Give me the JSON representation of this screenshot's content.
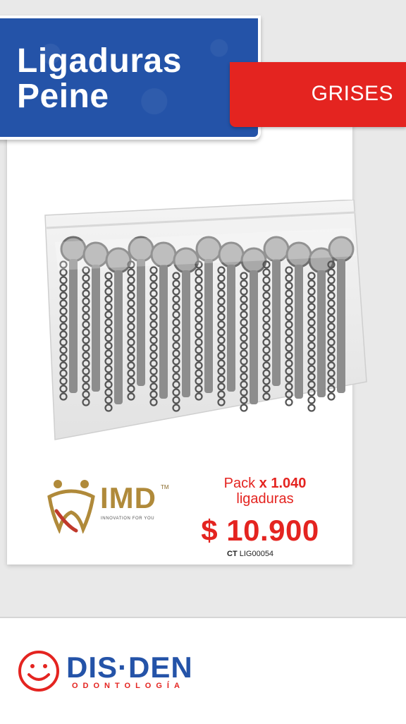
{
  "title": {
    "line1": "Ligaduras",
    "line2": "Peine"
  },
  "color_tag": "GRISES",
  "brand_logo": {
    "name": "IMD",
    "tm": "TM",
    "tagline": "INNOVATION FOR YOU",
    "icon": "tooth-people-icon"
  },
  "pack": {
    "prefix": "Pack",
    "quantity": "x 1.040",
    "unit": "ligaduras"
  },
  "price": "$ 10.900",
  "code": {
    "label": "CT",
    "value": "LIG00054"
  },
  "store_logo": {
    "name": "DIS·DEN",
    "sub": "ODONTOLOGÍA",
    "icon": "smiley-tooth-icon"
  },
  "colors": {
    "blue": "#2453a8",
    "red": "#e42420",
    "gold": "#b08a3a",
    "gray_product": "#8d8d8d"
  }
}
